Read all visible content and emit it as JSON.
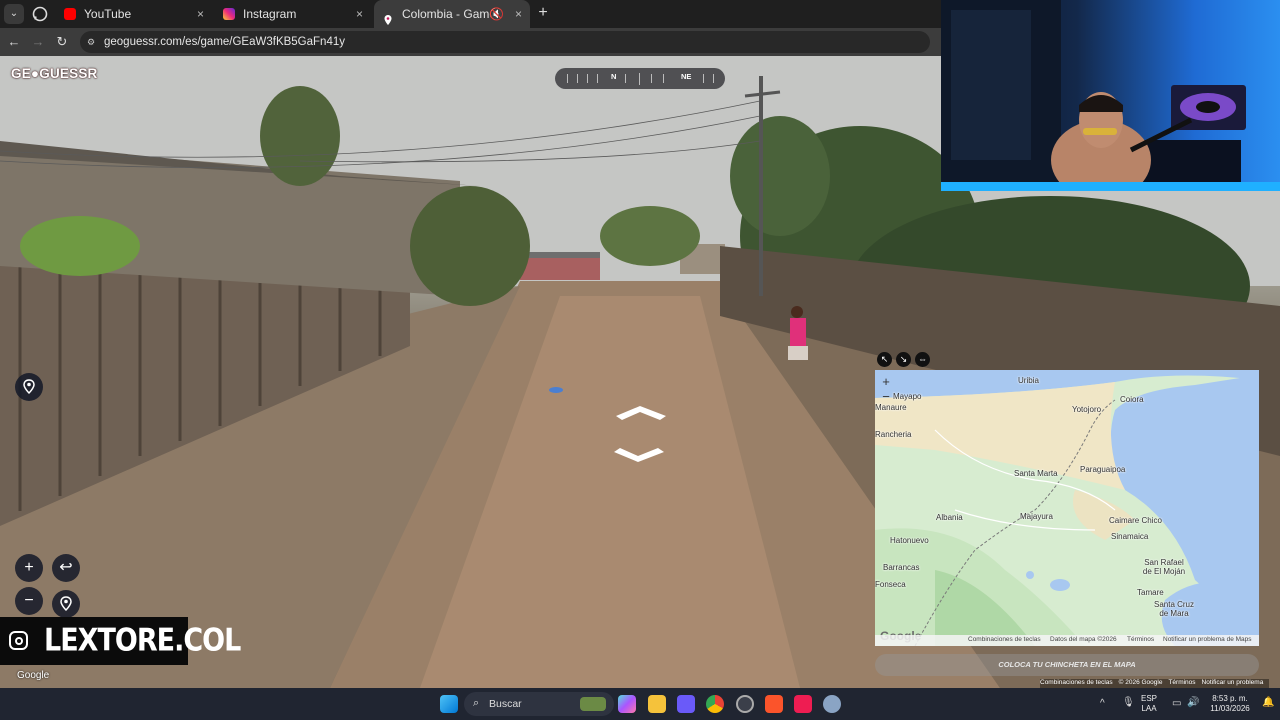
{
  "browser": {
    "tabs": [
      {
        "title": "YouTube",
        "icon": "youtube-icon",
        "color": "#ff0000"
      },
      {
        "title": "Instagram",
        "icon": "instagram-icon",
        "color": "#d62976"
      },
      {
        "title": "Colombia - Game - GeoGu",
        "icon": "map-pin-icon",
        "color": "#ffffff",
        "active": true
      }
    ],
    "close_glyph": "×",
    "new_tab_glyph": "+",
    "url": "geoguessr.com/es/game/GEaW3fKB5GaFn41y"
  },
  "game": {
    "logo": "GE●GUESSR",
    "compass": {
      "labels": [
        "N",
        "NE"
      ]
    },
    "controls": {
      "zoom_in": "+",
      "zoom_out": "−",
      "undo": "↩",
      "checkpoint": "◎"
    }
  },
  "overlay": {
    "watermark": "LEXTORE.COL"
  },
  "map": {
    "places": [
      {
        "name": "Uribia"
      },
      {
        "name": "Mayapo"
      },
      {
        "name": "Coiora"
      },
      {
        "name": "Yotojoro"
      },
      {
        "name": "Manaure"
      },
      {
        "name": "Rancheria"
      },
      {
        "name": "Santa Marta"
      },
      {
        "name": "Paraguaipoa"
      },
      {
        "name": "Albania"
      },
      {
        "name": "Majayura"
      },
      {
        "name": "Caimare Chico"
      },
      {
        "name": "Sinamaica"
      },
      {
        "name": "Hatonuevo"
      },
      {
        "name": "Barrancas"
      },
      {
        "name": "Fonseca"
      },
      {
        "name": "San Rafael de El Moján"
      },
      {
        "name": "Tamare"
      },
      {
        "name": "Santa Cruz de Mara"
      }
    ],
    "attribution": [
      "Combinaciones de teclas",
      "Datos del mapa ©2026",
      "Términos",
      "Notificar un problema de Maps"
    ],
    "guess_button": "COLOCA TU CHINCHETA EN EL MAPA",
    "google": "Google",
    "zoom_in": "+",
    "zoom_out": "−"
  },
  "street_attr": [
    "Combinaciones de teclas",
    "© 2026 Google",
    "Términos",
    "Notificar un problema"
  ],
  "street_google": "Google",
  "taskbar": {
    "search_placeholder": "Buscar",
    "language": "ESP",
    "language_sub": "LAA",
    "time": "8:53 p. m.",
    "date": "11/03/2026"
  }
}
